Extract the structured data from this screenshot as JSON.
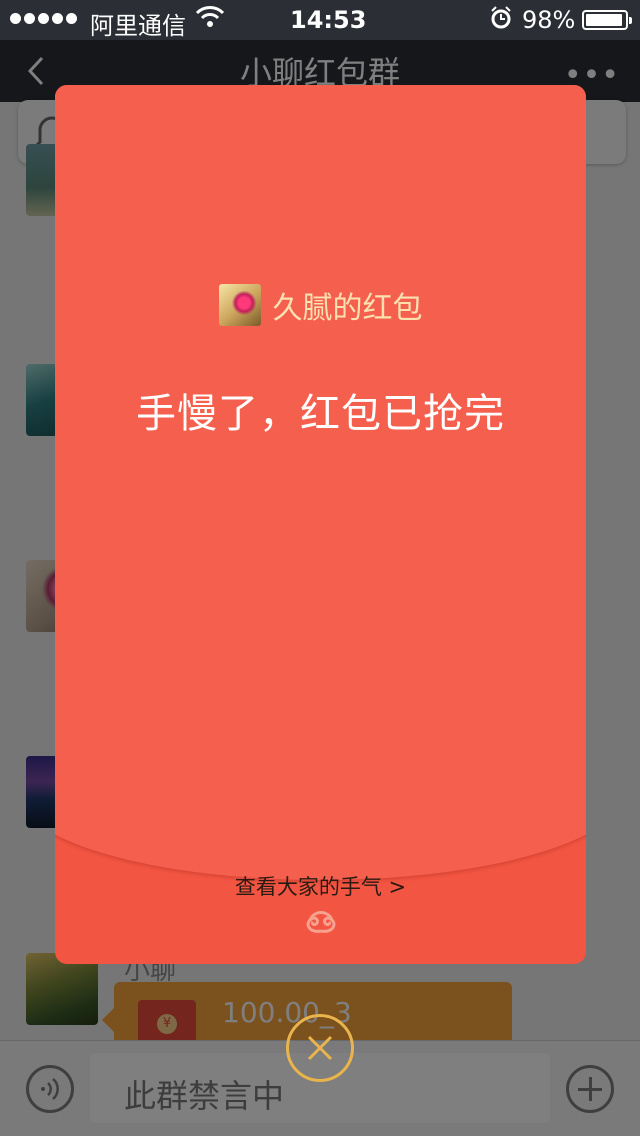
{
  "status_bar": {
    "carrier": "阿里通信",
    "time": "14:53",
    "battery": "98%"
  },
  "nav": {
    "title": "小聊红包群"
  },
  "chat": {
    "sender_name": "小聊",
    "red_packet_amount": "100.00_3"
  },
  "input": {
    "placeholder": "此群禁言中"
  },
  "modal": {
    "sender_label": "久腻的红包",
    "result": "手慢了，红包已抢完",
    "view_luck": "查看大家的手气 >"
  },
  "colors": {
    "nav_bg": "#2b2e34",
    "packet_red": "#f25542",
    "packet_gold_text": "#fbe0b0",
    "close_ring": "#e9b44c"
  }
}
